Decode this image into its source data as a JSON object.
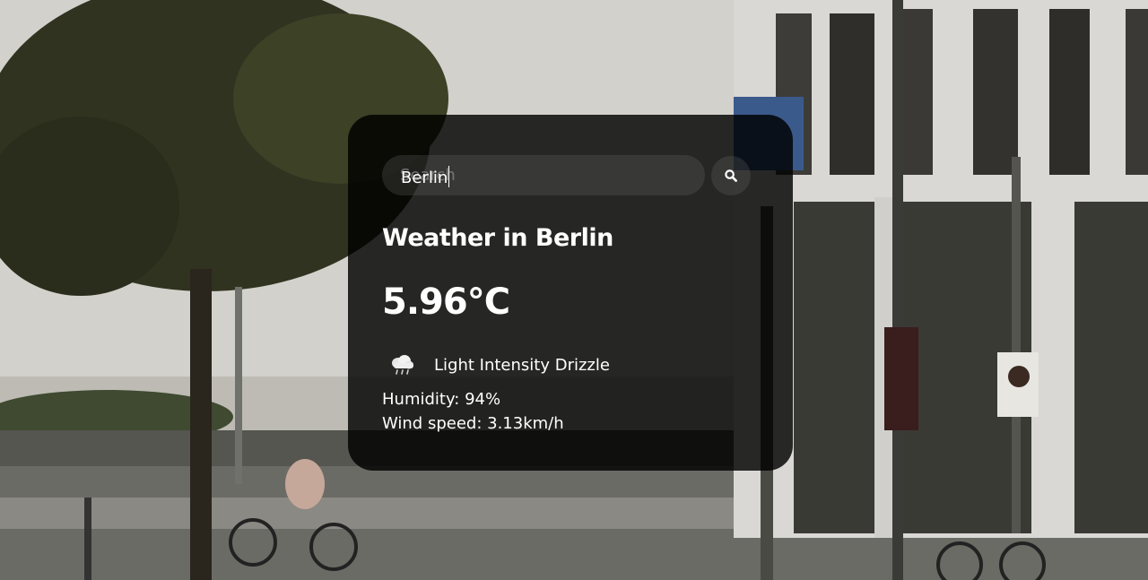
{
  "search": {
    "value": "Berlin",
    "placeholder": "Search"
  },
  "weather": {
    "title": "Weather in Berlin",
    "temperature": "5.96°C",
    "icon": "cloud-drizzle-icon",
    "description": "Light Intensity Drizzle",
    "humidity": "Humidity: 94%",
    "wind_speed": "Wind speed: 3.13km/h"
  },
  "colors": {
    "card_background": "#000000",
    "text": "#ffffff"
  }
}
